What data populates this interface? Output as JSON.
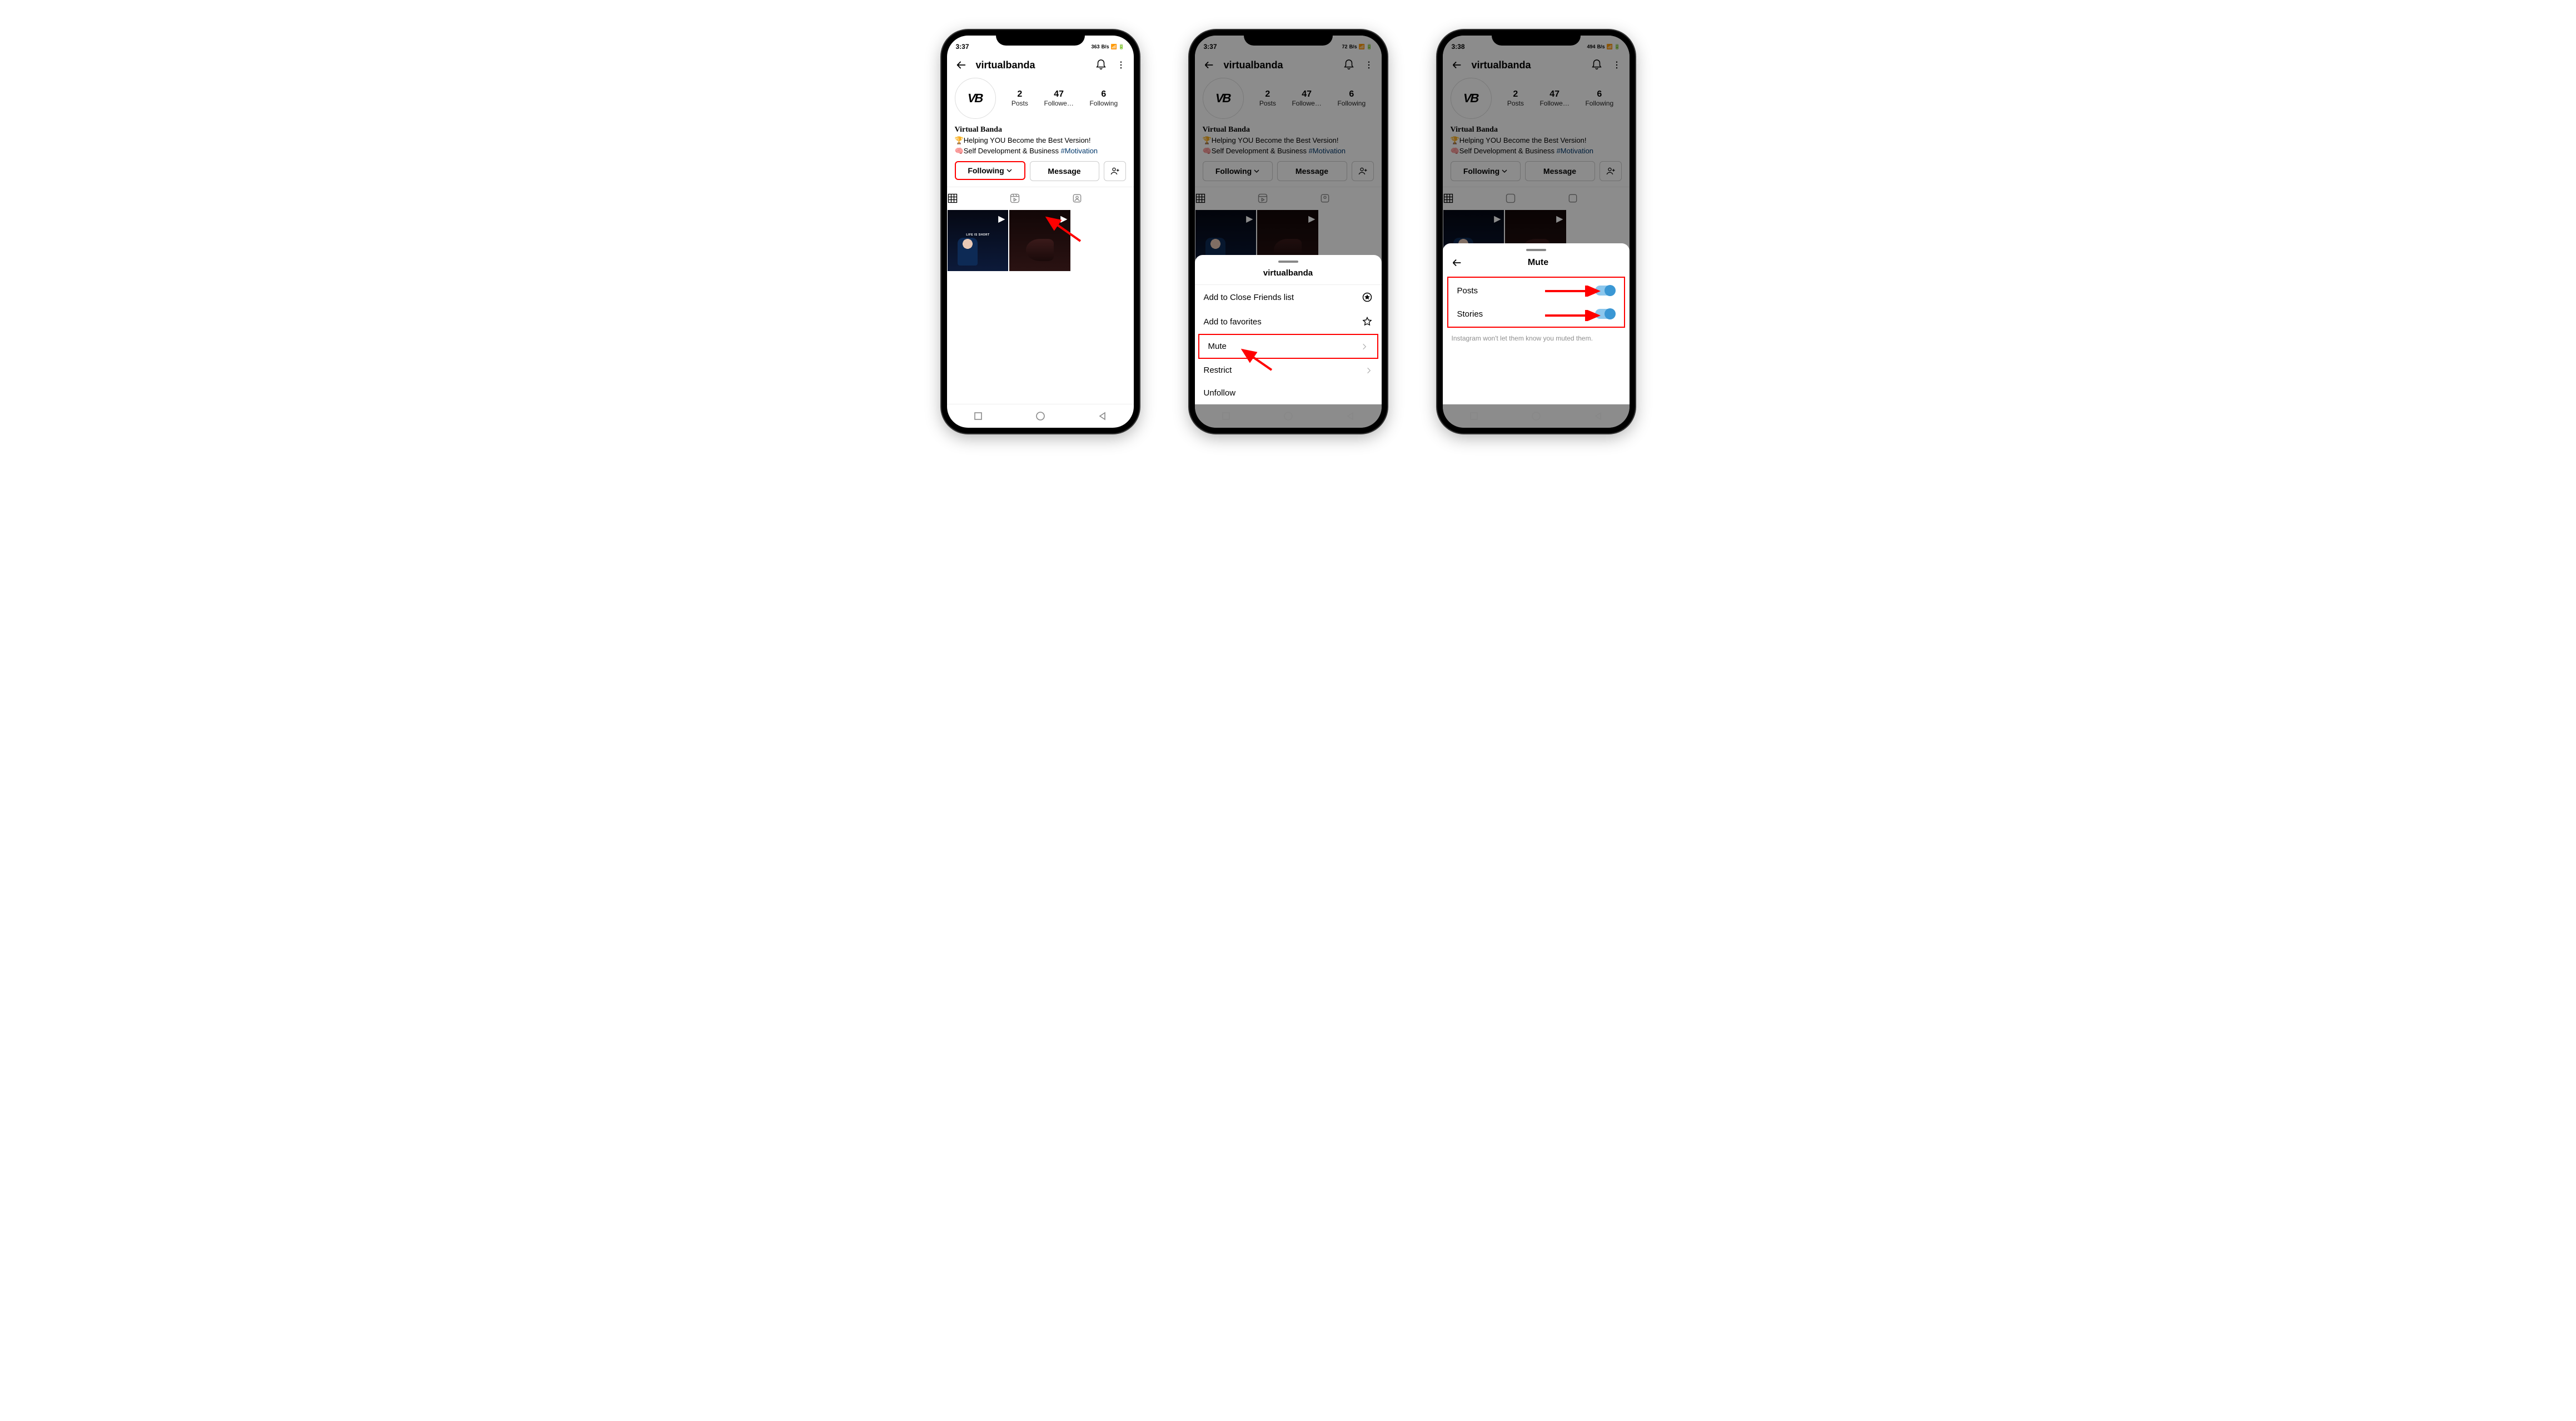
{
  "phones": {
    "a": {
      "time": "3:37",
      "speed": "363",
      "speedUnit": "B/s"
    },
    "b": {
      "time": "3:37",
      "speed": "72",
      "speedUnit": "B/s"
    },
    "c": {
      "time": "3:38",
      "speed": "494",
      "speedUnit": "B/s"
    }
  },
  "profile": {
    "username": "virtualbanda",
    "avatar_text": "VB",
    "stats": {
      "posts": {
        "n": "2",
        "l": "Posts"
      },
      "followers": {
        "n": "47",
        "l": "Followe…"
      },
      "following": {
        "n": "6",
        "l": "Following"
      }
    },
    "display_name": "Virtual Banda",
    "bio_line1_emoji": "🏆",
    "bio_line1": "Helping YOU Become the Best Version!",
    "bio_line2_emoji": "🧠",
    "bio_line2": "Self Development & Business ",
    "bio_hashtag": "#Motivation",
    "btn_following": "Following",
    "btn_message": "Message"
  },
  "sheet": {
    "title": "virtualbanda",
    "items": {
      "close": "Add to Close Friends list",
      "fav": "Add to favorites",
      "mute": "Mute",
      "restrict": "Restrict",
      "unfollow": "Unfollow"
    }
  },
  "mute": {
    "title": "Mute",
    "posts": "Posts",
    "stories": "Stories",
    "note": "Instagram won't let them know you muted them."
  },
  "thumb_text": "LIFE IS SHORT"
}
